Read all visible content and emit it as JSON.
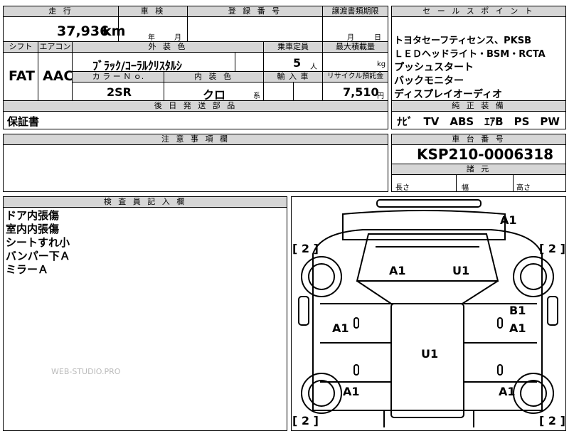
{
  "header": {
    "mileage_label": "走 行",
    "shaken_label": "車 検",
    "reg_no_label": "登 録 番 号",
    "doc_deadline_label": "譲渡書類期限",
    "sales_points_label": "セ ー ル ス ポ イ ン ト",
    "shift_label": "シフト",
    "ac_label": "エアコン",
    "exterior_color_label": "外 装 色",
    "capacity_label": "乗車定員",
    "max_load_label": "最大積載量",
    "color_no_label": "カ ラ ー Ｎ ｏ.",
    "interior_color_label": "内 装 色",
    "import_label": "輸 入 車",
    "recycle_label": "リサイクル預託金",
    "later_parts_label": "後 日 発 送 部 品",
    "standard_equip_label": "純 正 装 備",
    "notes_label": "注 意 事 項 欄",
    "chassis_label": "車 台 番 号",
    "dimensions_label": "諸 元",
    "inspector_label": "検 査 員 記 入 欄"
  },
  "values": {
    "mileage": "37,936",
    "mileage_unit": "km",
    "shaken_year": "年",
    "shaken_month": "月",
    "doc_month": "月",
    "doc_day": "日",
    "shift": "FAT",
    "ac": "AAC",
    "exterior_color": "ﾌﾞﾗｯｸ/ｺｰﾗﾙｸﾘｽﾀﾙｼ",
    "capacity": "5",
    "capacity_unit": "人",
    "max_load_unit": "kg",
    "color_no": "2SR",
    "interior_color": "クロ",
    "interior_suffix": "系",
    "recycle_fee": "7,510",
    "recycle_unit": "円",
    "later_parts": "保証書",
    "standard_equipment": "ﾅﾋﾞ　TV　ABS　ｴｱB　PS　PW",
    "chassis_no": "KSP210-0006318",
    "length_label": "長さ",
    "width_label": "幅",
    "height_label": "高さ"
  },
  "sales_points": [
    "トヨタセーフティセンス、PKSB",
    "ＬＥＤヘッドライト・BSM・RCTA",
    "プッシュスタート",
    "バックモニター",
    "ディスプレイオーディオ"
  ],
  "inspector_notes": [
    "ドア内張傷",
    "室内内張傷",
    "シートすれ小",
    "バンパー下Ａ",
    "ミラーＡ"
  ],
  "diagram_codes": {
    "front_right": "A1",
    "side_left_top": "[ 2 ]",
    "side_right_top": "[ 2 ]",
    "hood_left": "A1",
    "hood_right": "U1",
    "front_door_right_top": "B1",
    "front_door_right": "A1",
    "front_door_left": "A1",
    "roof": "U1",
    "rear_left": "A1",
    "rear_right": "A1",
    "side_left_bottom": "[ 2 ]",
    "side_right_bottom": "[ 2 ]"
  },
  "watermark": "WEB-STUDIO.PRO"
}
